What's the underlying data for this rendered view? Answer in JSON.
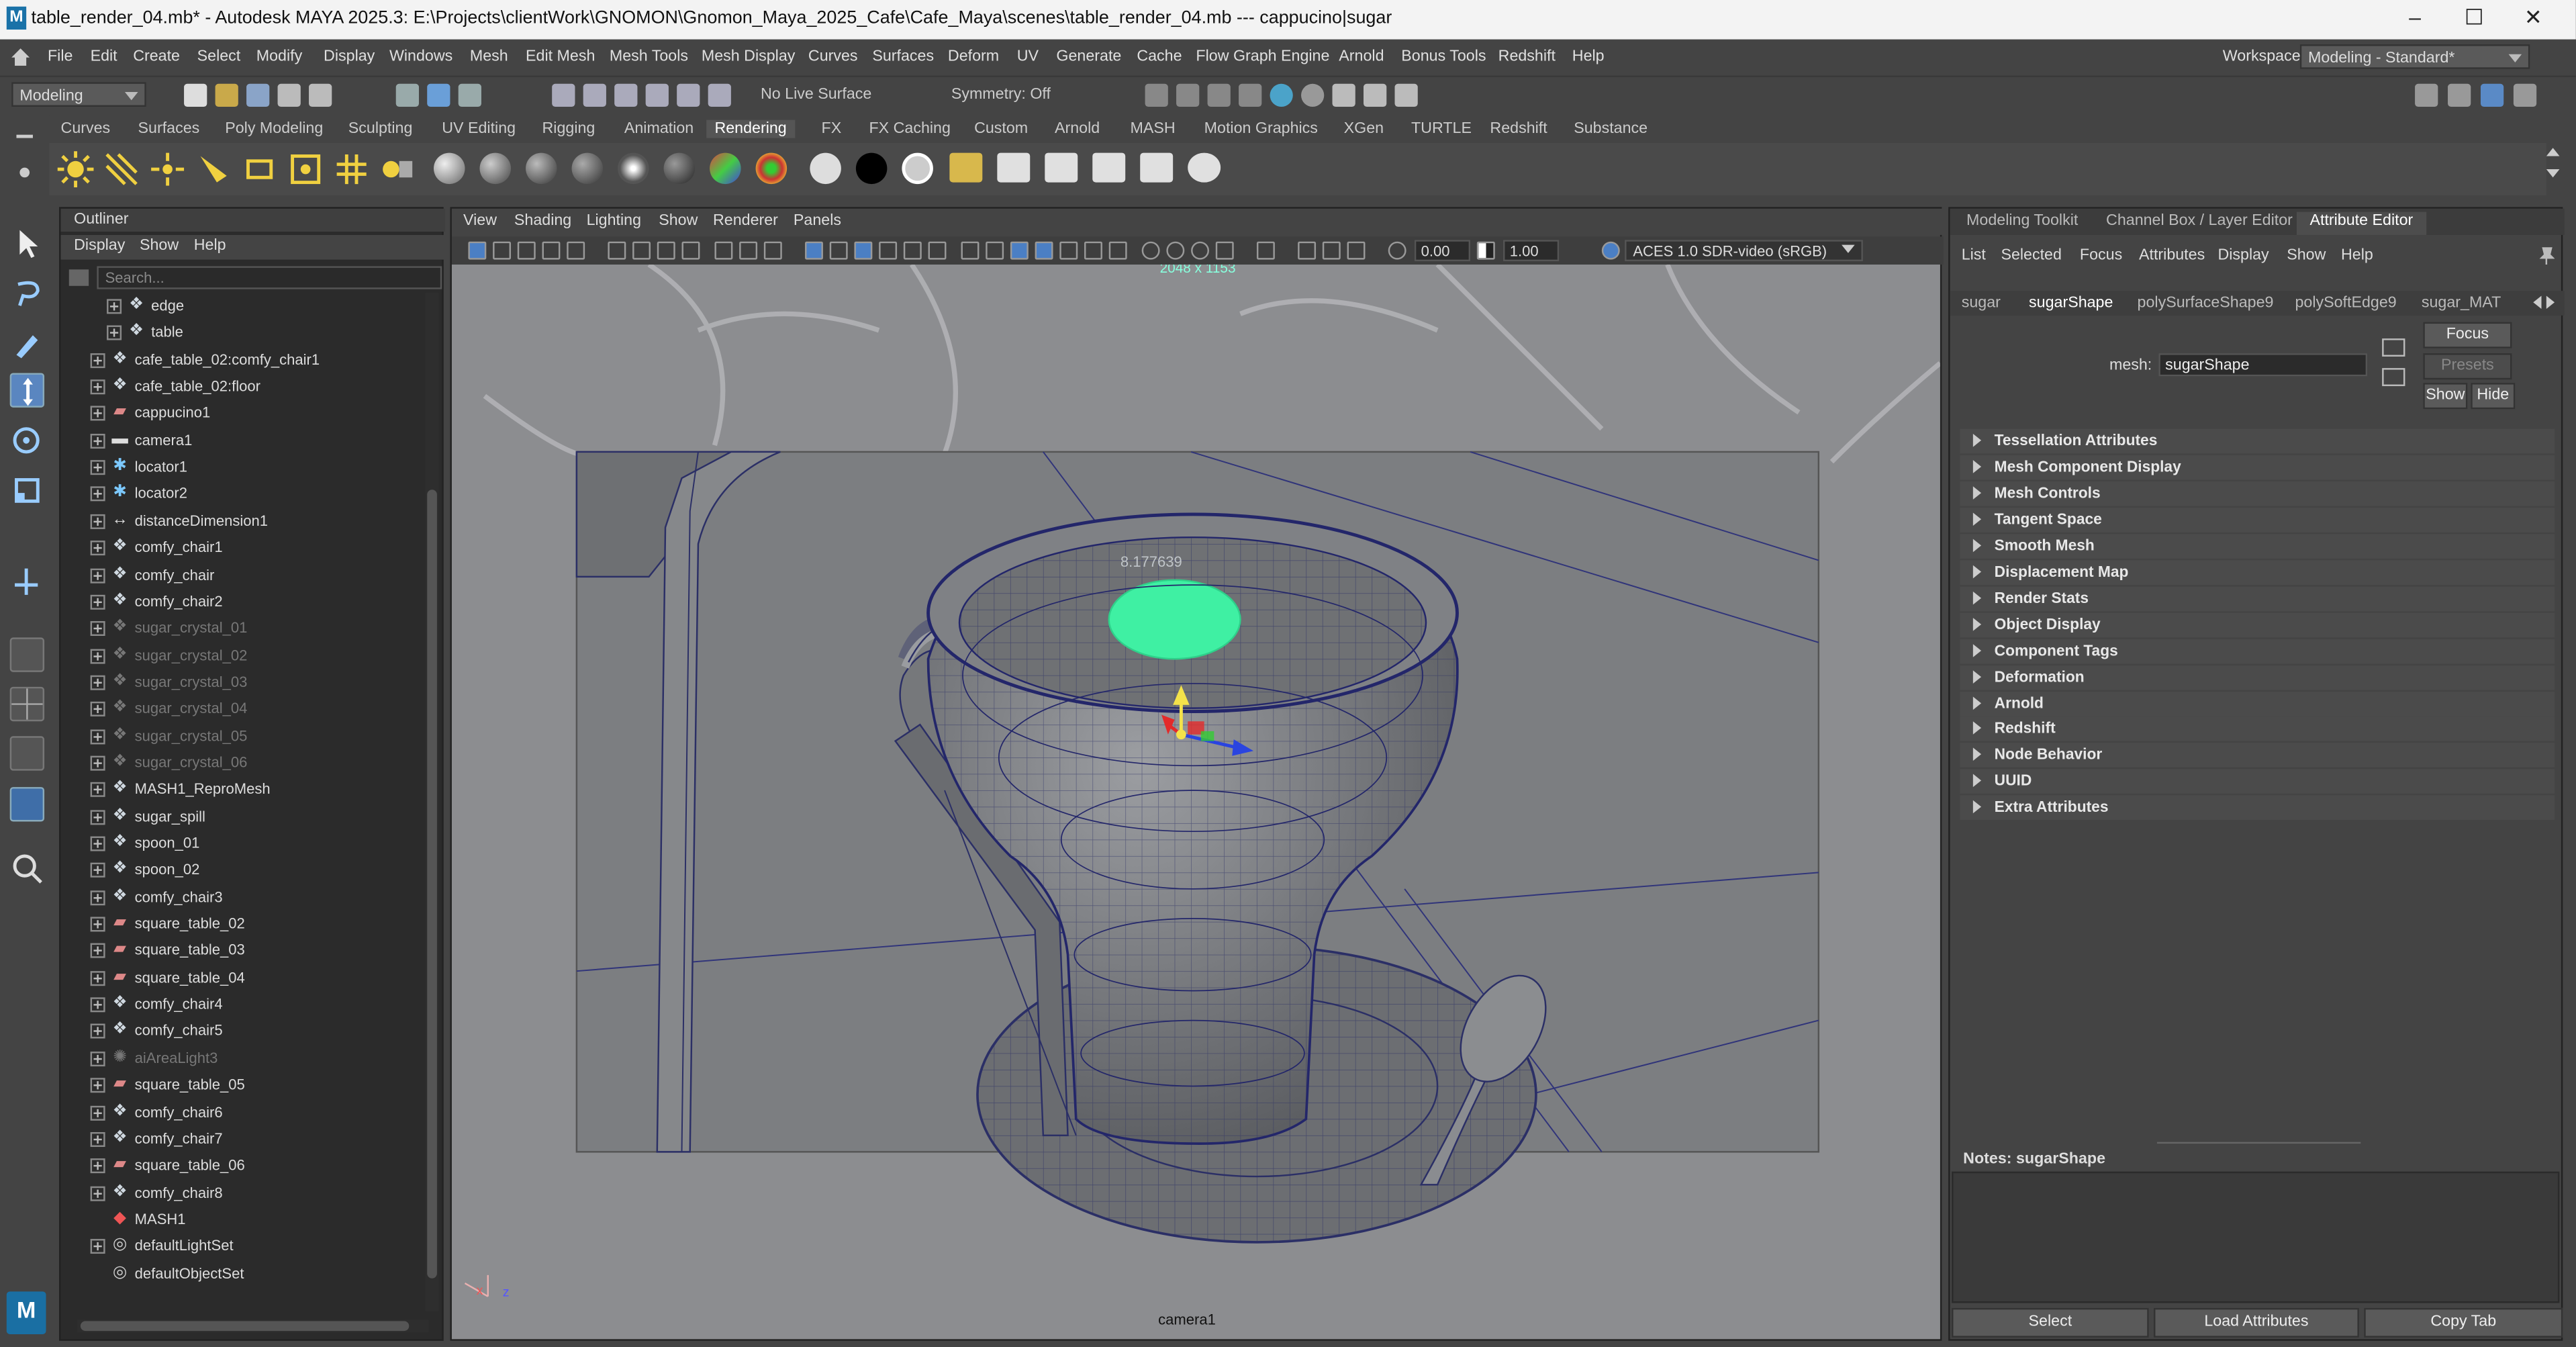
{
  "window": {
    "title": "table_render_04.mb* - Autodesk MAYA 2025.3: E:\\Projects\\clientWork\\GNOMON\\Gnomon_Maya_2025_Cafe\\Cafe_Maya\\scenes\\table_render_04.mb   ---   cappucino|sugar",
    "minimize": "–",
    "maximize": "☐",
    "close": "✕",
    "app_badge": "M"
  },
  "menubar": {
    "items": [
      "File",
      "Edit",
      "Create",
      "Select",
      "Modify",
      "Display",
      "Windows",
      "Mesh",
      "Edit Mesh",
      "Mesh Tools",
      "Mesh Display",
      "Curves",
      "Surfaces",
      "Deform",
      "UV",
      "Generate",
      "Cache",
      "Flow Graph Engine",
      "Arnold",
      "Bonus Tools",
      "Redshift",
      "Help"
    ],
    "workspace_label": "Workspace:",
    "workspace_value": "Modeling - Standard*"
  },
  "statusline": {
    "menuset": "Modeling",
    "live_surface": "No Live Surface",
    "symmetry": "Symmetry: Off"
  },
  "shelf": {
    "tabs": [
      "Curves",
      "Surfaces",
      "Poly Modeling",
      "Sculpting",
      "UV Editing",
      "Rigging",
      "Animation",
      "Rendering",
      "FX",
      "FX Caching",
      "Custom",
      "Arnold",
      "MASH",
      "Motion Graphics",
      "XGen",
      "TURTLE",
      "Redshift",
      "Substance"
    ],
    "active_tab": "Rendering"
  },
  "outliner": {
    "title": "Outliner",
    "menu": [
      "Display",
      "Show",
      "Help"
    ],
    "search_placeholder": "Search...",
    "items": [
      {
        "label": "edge",
        "icon": "mesh",
        "dim": false,
        "indent": true
      },
      {
        "label": "table",
        "icon": "mesh",
        "dim": false,
        "indent": true
      },
      {
        "label": "cafe_table_02:comfy_chair1",
        "icon": "mesh",
        "dim": false
      },
      {
        "label": "cafe_table_02:floor",
        "icon": "mesh",
        "dim": false
      },
      {
        "label": "cappucino1",
        "icon": "deform",
        "dim": false
      },
      {
        "label": "camera1",
        "icon": "camera",
        "dim": false
      },
      {
        "label": "locator1",
        "icon": "locator",
        "dim": false
      },
      {
        "label": "locator2",
        "icon": "locator",
        "dim": false
      },
      {
        "label": "distanceDimension1",
        "icon": "distance",
        "dim": false
      },
      {
        "label": "comfy_chair1",
        "icon": "mesh",
        "dim": false
      },
      {
        "label": "comfy_chair",
        "icon": "mesh",
        "dim": false
      },
      {
        "label": "comfy_chair2",
        "icon": "mesh",
        "dim": false
      },
      {
        "label": "sugar_crystal_01",
        "icon": "mesh",
        "dim": true
      },
      {
        "label": "sugar_crystal_02",
        "icon": "mesh",
        "dim": true
      },
      {
        "label": "sugar_crystal_03",
        "icon": "mesh",
        "dim": true
      },
      {
        "label": "sugar_crystal_04",
        "icon": "mesh",
        "dim": true
      },
      {
        "label": "sugar_crystal_05",
        "icon": "mesh",
        "dim": true
      },
      {
        "label": "sugar_crystal_06",
        "icon": "mesh",
        "dim": true
      },
      {
        "label": "MASH1_ReproMesh",
        "icon": "mesh",
        "dim": false
      },
      {
        "label": "sugar_spill",
        "icon": "mesh",
        "dim": false
      },
      {
        "label": "spoon_01",
        "icon": "mesh",
        "dim": false
      },
      {
        "label": "spoon_02",
        "icon": "mesh",
        "dim": false
      },
      {
        "label": "comfy_chair3",
        "icon": "mesh",
        "dim": false
      },
      {
        "label": "square_table_02",
        "icon": "deform",
        "dim": false
      },
      {
        "label": "square_table_03",
        "icon": "deform",
        "dim": false
      },
      {
        "label": "square_table_04",
        "icon": "deform",
        "dim": false
      },
      {
        "label": "comfy_chair4",
        "icon": "mesh",
        "dim": false
      },
      {
        "label": "comfy_chair5",
        "icon": "mesh",
        "dim": false
      },
      {
        "label": "aiAreaLight3",
        "icon": "light",
        "dim": true
      },
      {
        "label": "square_table_05",
        "icon": "deform",
        "dim": false
      },
      {
        "label": "comfy_chair6",
        "icon": "mesh",
        "dim": false
      },
      {
        "label": "comfy_chair7",
        "icon": "mesh",
        "dim": false
      },
      {
        "label": "square_table_06",
        "icon": "deform",
        "dim": false
      },
      {
        "label": "comfy_chair8",
        "icon": "mesh",
        "dim": false
      },
      {
        "label": "MASH1",
        "icon": "mash",
        "dim": false,
        "noexp": true
      },
      {
        "label": "defaultLightSet",
        "icon": "set",
        "dim": false
      },
      {
        "label": "defaultObjectSet",
        "icon": "set",
        "dim": false,
        "noexp": true
      }
    ]
  },
  "viewport": {
    "menu": [
      "View",
      "Shading",
      "Lighting",
      "Show",
      "Renderer",
      "Panels"
    ],
    "exposure": "0.00",
    "gamma": "1.00",
    "colorspace": "ACES 1.0 SDR-video (sRGB)",
    "resolution": "2048 x 1153",
    "camera_label": "camera1",
    "distance_readout": "8.177639",
    "axis_x": "x",
    "axis_z": "z"
  },
  "attribute_editor": {
    "tabs": [
      "Modeling Toolkit",
      "Channel Box / Layer Editor",
      "Attribute Editor"
    ],
    "active_tab": "Attribute Editor",
    "menu": [
      "List",
      "Selected",
      "Focus",
      "Attributes",
      "Display",
      "Show",
      "Help"
    ],
    "node_tabs": [
      "sugar",
      "sugarShape",
      "polySurfaceShape9",
      "polySoftEdge9",
      "sugar_MAT"
    ],
    "active_node": "sugarShape",
    "mesh_label": "mesh:",
    "mesh_value": "sugarShape",
    "focus_btn": "Focus",
    "presets_btn": "Presets",
    "show_btn": "Show",
    "hide_btn": "Hide",
    "sections": [
      "Tessellation Attributes",
      "Mesh Component Display",
      "Mesh Controls",
      "Tangent Space",
      "Smooth Mesh",
      "Displacement Map",
      "Render Stats",
      "Object Display",
      "Component Tags",
      "Deformation",
      "Arnold",
      "Redshift",
      "Node Behavior",
      "UUID",
      "Extra Attributes"
    ],
    "notes_label": "Notes:  sugarShape",
    "bottom_buttons": [
      "Select",
      "Load Attributes",
      "Copy Tab"
    ]
  }
}
